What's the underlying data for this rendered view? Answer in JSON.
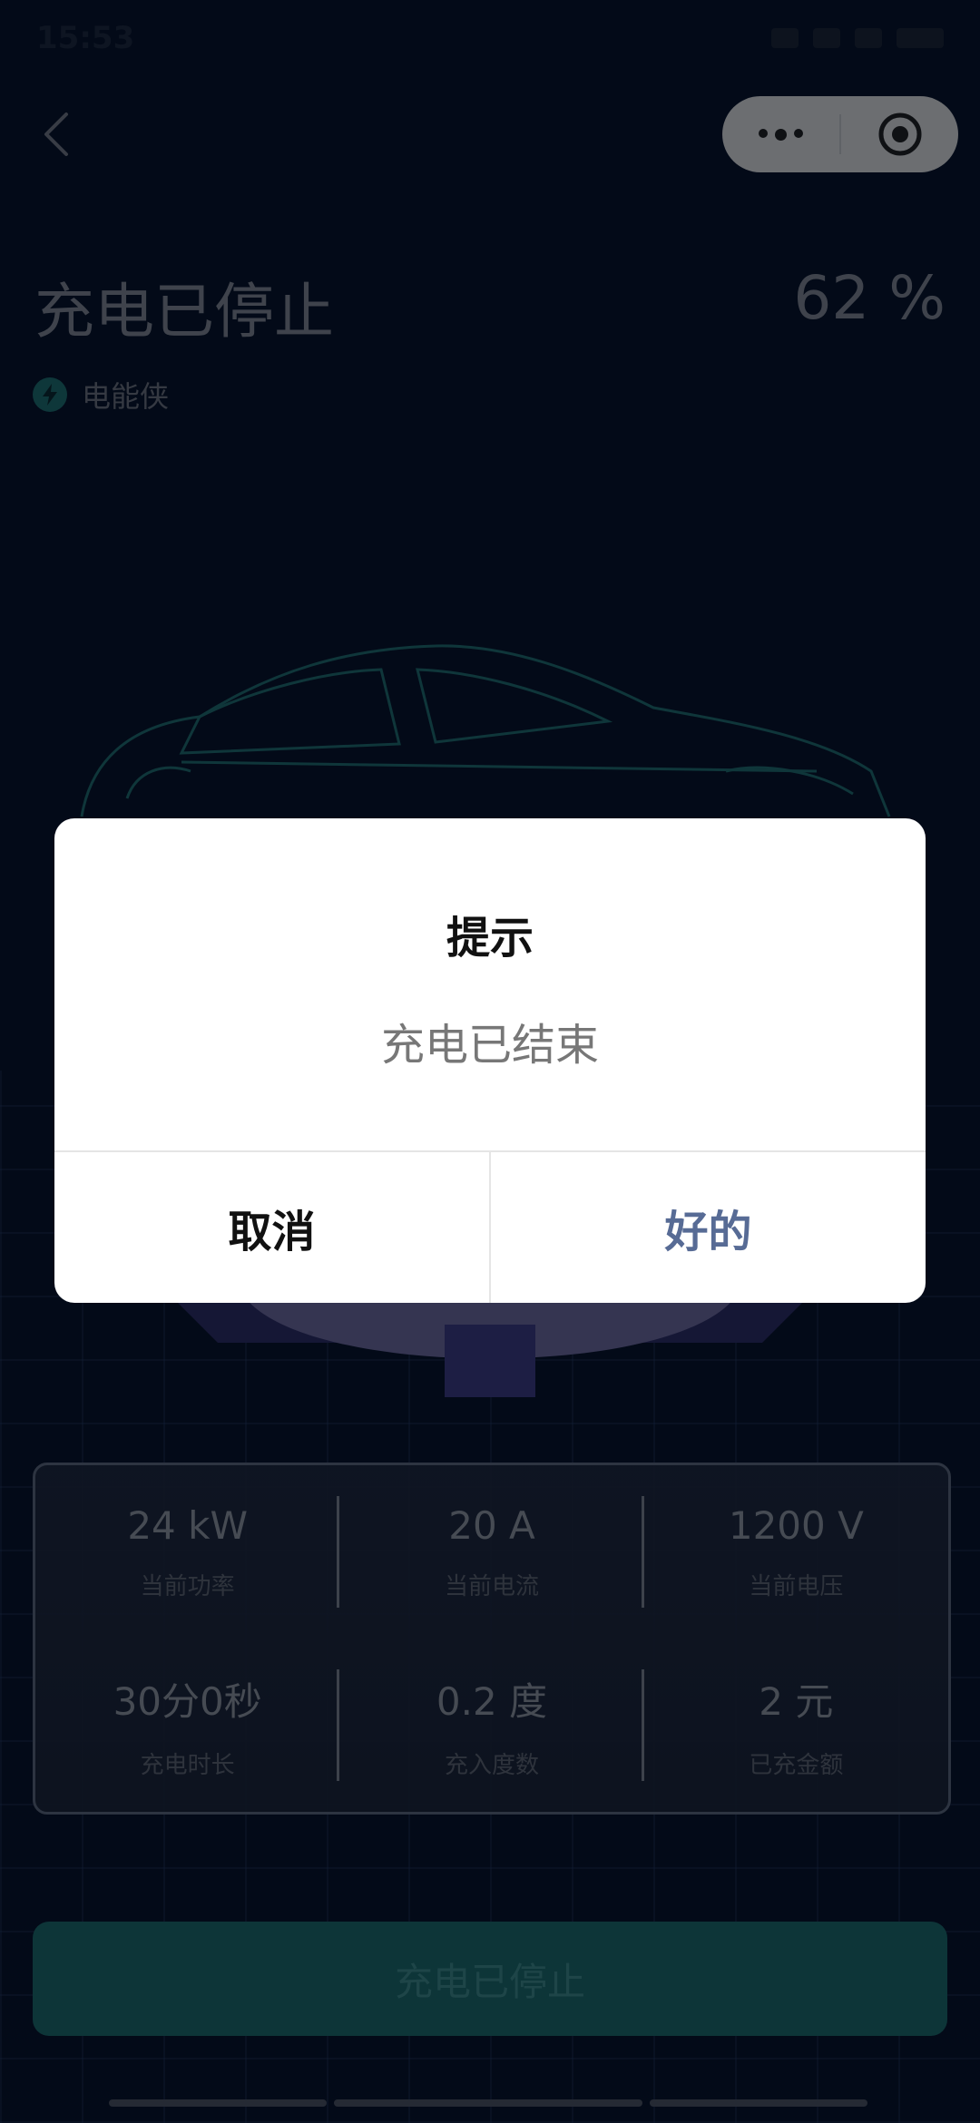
{
  "status_bar": {
    "time": "15:53"
  },
  "header": {
    "title": "充电已停止",
    "percent": "62 %",
    "brand": "电能侠"
  },
  "stats": [
    {
      "value": "24 kW",
      "label": "当前功率"
    },
    {
      "value": "20 A",
      "label": "当前电流"
    },
    {
      "value": "1200 V",
      "label": "当前电压"
    },
    {
      "value": "30分0秒",
      "label": "充电时长"
    },
    {
      "value": "0.2 度",
      "label": "充入度数"
    },
    {
      "value": "2 元",
      "label": "已充金额"
    }
  ],
  "stop_button_label": "充电已停止",
  "dialog": {
    "title": "提示",
    "message": "充电已结束",
    "cancel_label": "取消",
    "ok_label": "好的"
  },
  "colors": {
    "background": "#071530",
    "accent_teal": "#1b6a70",
    "dialog_ok": "#576b95"
  },
  "icons": {
    "back": "chevron-left-icon",
    "more": "more-dots-icon",
    "close_target": "target-circle-icon",
    "brand": "lightning-icon"
  }
}
